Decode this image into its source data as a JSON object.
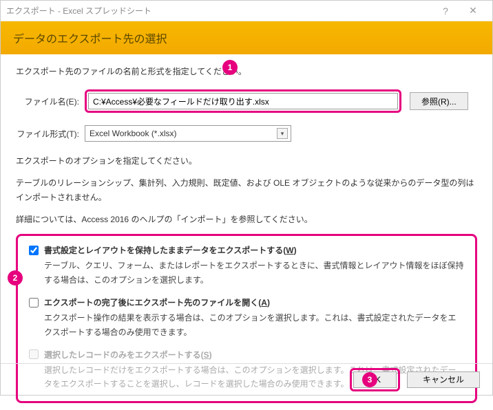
{
  "window": {
    "title": "エクスポート - Excel スプレッドシート"
  },
  "header": {
    "title": "データのエクスポート先の選択"
  },
  "instruction": "エクスポート先のファイルの名前と形式を指定してください。",
  "filename": {
    "label": "ファイル名(E):",
    "value": "C:¥Access¥必要なフィールドだけ取り出す.xlsx"
  },
  "browse_label": "参照(R)...",
  "format": {
    "label": "ファイル形式(T):",
    "value": "Excel Workbook (*.xlsx)"
  },
  "options_intro1": "エクスポートのオプションを指定してください。",
  "options_intro2": "テーブルのリレーションシップ、集計列、入力規則、既定値、および OLE オブジェクトのような従来からのデータ型の列はインポートされません。",
  "options_intro3": "詳細については、Access 2016 のヘルプの「インポート」を参照してください。",
  "options": [
    {
      "label_prefix": "書式設定とレイアウトを保持したままデータをエクスポートする(",
      "hotkey": "W",
      "label_suffix": ")",
      "desc": "テーブル、クエリ、フォーム、またはレポートをエクスポートするときに、書式情報とレイアウト情報をほぼ保持する場合は、このオプションを選択します。",
      "checked": true,
      "enabled": true
    },
    {
      "label_prefix": "エクスポートの完了後にエクスポート先のファイルを開く(",
      "hotkey": "A",
      "label_suffix": ")",
      "desc": "エクスポート操作の結果を表示する場合は、このオプションを選択します。これは、書式設定されたデータをエクスポートする場合のみ使用できます。",
      "checked": false,
      "enabled": true
    },
    {
      "label_prefix": "選択したレコードのみをエクスポートする(",
      "hotkey": "S",
      "label_suffix": ")",
      "desc": "選択したレコードだけをエクスポートする場合は、このオプションを選択します。これは、書式設定されたデータをエクスポートすることを選択し、レコードを選択した場合のみ使用できます。",
      "checked": false,
      "enabled": false
    }
  ],
  "footer": {
    "ok": "OK",
    "cancel": "キャンセル"
  },
  "callouts": [
    "1",
    "2",
    "3"
  ]
}
